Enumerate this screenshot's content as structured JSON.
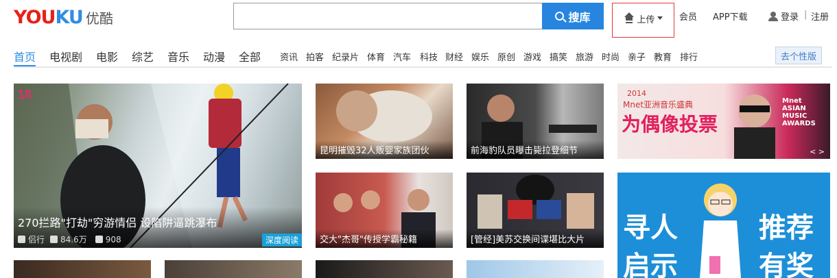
{
  "logo": {
    "y": "YOU",
    "k": "KU",
    "cn": "优酷"
  },
  "search": {
    "placeholder": "",
    "button_label": "搜库"
  },
  "header": {
    "upload_label": "上传",
    "member_label": "会员",
    "app_label": "APP下载",
    "login_label": "登录",
    "separator": "|",
    "register_label": "注册"
  },
  "nav": {
    "main": [
      "首页",
      "电视剧",
      "电影",
      "综艺",
      "音乐",
      "动漫",
      "全部"
    ],
    "sub": [
      "资讯",
      "拍客",
      "纪录片",
      "体育",
      "汽车",
      "科技",
      "财经",
      "娱乐",
      "原创",
      "游戏",
      "搞笑",
      "旅游",
      "时尚",
      "亲子",
      "教育",
      "排行"
    ],
    "personal_label": "去个性版"
  },
  "feature": {
    "title": "270拦路\"打劫\"穷游情侣 设陷阱逼跳瀑布",
    "uploader": "侣行",
    "plays": "84.6万",
    "comments": "908",
    "badge": "深度阅读"
  },
  "tiles": [
    {
      "caption": "昆明摧毁32人贩婴家族团伙"
    },
    {
      "caption": "前海豹队员曝击毙拉登细节"
    },
    {
      "caption": "交大\"杰哥\"传授学霸秘籍"
    },
    {
      "caption": "[管经]美苏交换间谍堪比大片"
    }
  ],
  "ad1": {
    "year": "2014",
    "subtitle": "Mnet亚洲音乐盛典",
    "title": "为偶像投票",
    "logo_text": "Mnet ASIAN MUSIC AWARDS",
    "nav": "< >"
  },
  "ad2": {
    "left_top": "寻人",
    "left_bottom": "启示",
    "right_top": "推荐",
    "right_bottom": "有奖"
  },
  "colors": {
    "accent": "#2f8de4",
    "search_button": "#2785e0",
    "upload_border": "#e03a3a",
    "badge": "#1ba0d8"
  }
}
